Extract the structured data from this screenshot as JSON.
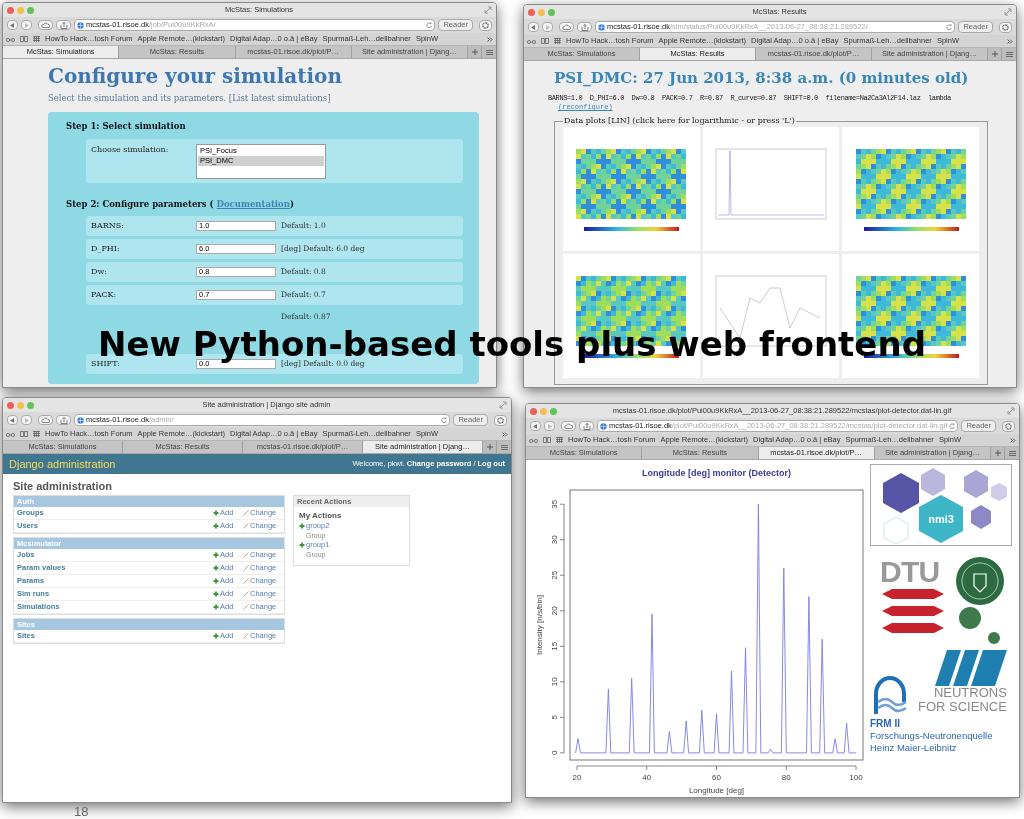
{
  "slide": {
    "headline": "New Python-based tools plus web frontend",
    "page_number": "18"
  },
  "windows": [
    {
      "kind": "simulations",
      "title": "McStas: Simulations",
      "url_host": "mcstas-01.risoe.dk",
      "url_path": "/job/Pui00u9KkRxA/",
      "reader": "Reader",
      "bookmarks": [
        "HowTo Hack…tosh Forum",
        "Apple Remote…(kickstart)",
        "Digital Adap…0 o.ä | eBay",
        "Spurmaß-Leh…dellbahner",
        "SpinW"
      ],
      "tabs": [
        {
          "label": "McStas: Simulations",
          "selected": true
        },
        {
          "label": "McStas: Results",
          "selected": false
        },
        {
          "label": "mcstas-01.risoe.dk/plot/P…",
          "selected": false
        },
        {
          "label": "Site administration | Djang…",
          "selected": false
        }
      ],
      "content": {
        "heading": "Configure your simulation",
        "intro": "Select the simulation and its parameters.",
        "intro_link": "[List latest simulations]",
        "step1": "Step 1: Select simulation",
        "choose_label": "Choose simulation:",
        "options": [
          {
            "label": "PSI_Focus",
            "selected": false
          },
          {
            "label": "PSI_DMC",
            "selected": true
          }
        ],
        "step2": "Step 2: Configure parameters (",
        "step2_link": "Documentation",
        "step2_end": ")",
        "params": [
          {
            "label": "BARNS:",
            "value": "1.0",
            "default": "Default: 1.0"
          },
          {
            "label": "D_PHI:",
            "value": "6.0",
            "default": "[deg] Default: 6.0 deg"
          },
          {
            "label": "Dw:",
            "value": "0.8",
            "default": "Default: 0.8"
          },
          {
            "label": "PACK:",
            "value": "0.7",
            "default": "Default: 0.7"
          },
          {
            "default": "Default: 0.87"
          },
          {
            "label": "SHIFT:",
            "value": "0.0",
            "default": "[deg] Default: 0.0 deg"
          }
        ]
      }
    },
    {
      "kind": "results",
      "title": "McStas: Results",
      "url_host": "mcstas-01.risoe.dk",
      "url_path": "/sim/status/Pui00u9KkRxA__2013-06-27_08:38:21.289522/",
      "reader": "Reader",
      "bookmarks": [
        "HowTo Hack…tosh Forum",
        "Apple Remote…(kickstart)",
        "Digital Adap…0 o.ä | eBay",
        "Spurmaß-Leh…dellbahner",
        "SpinW"
      ],
      "tabs": [
        {
          "label": "McStas: Simulations",
          "selected": false
        },
        {
          "label": "McStas: Results",
          "selected": true
        },
        {
          "label": "mcstas-01.risoe.dk/plot/P…",
          "selected": false
        },
        {
          "label": "Site administration | Djang…",
          "selected": false
        }
      ],
      "content": {
        "heading": "PSI_DMC: 27 Jun 2013, 8:38 a.m. (0 minutes old)",
        "params_line": "BARNS=1.0  D_PHI=6.0  Dw=0.8  PACK=0.7  R=0.87  R_curve=0.87  SHIFT=0.0  filename=Na2Ca3Al2F14.laz  lambda",
        "reconfigure": "(reconfigure)",
        "legend": "Data plots [LIN] (click here for logarithmic - or press 'L')",
        "plots": [
          {
            "kind": "map"
          },
          {
            "kind": "peak"
          },
          {
            "kind": "map"
          },
          {
            "kind": "map"
          },
          {
            "kind": "line"
          },
          {
            "kind": "map"
          }
        ]
      }
    },
    {
      "kind": "admin",
      "title": "Site administration | Django site admin",
      "url_host": "mcstas-01.risoe.dk",
      "url_path": "/admin/",
      "reader": "Reader",
      "bookmarks": [
        "HowTo Hack…tosh Forum",
        "Apple Remote…(kickstart)",
        "Digital Adap…0 o.ä | eBay",
        "Spurmaß-Leh…dellbahner",
        "SpinW"
      ],
      "tabs": [
        {
          "label": "McStas: Simulations",
          "selected": false
        },
        {
          "label": "McStas: Results",
          "selected": false
        },
        {
          "label": "mcstas-01.risoe.dk/plot/P…",
          "selected": false
        },
        {
          "label": "Site administration | Djang…",
          "selected": true
        }
      ],
      "content": {
        "brand": "Django administration",
        "welcome": "Welcome, pkwi.",
        "user_links": [
          "Change password",
          "Log out"
        ],
        "link_separator": "/",
        "page_title": "Site administration",
        "modules": [
          {
            "name": "Auth",
            "models": [
              {
                "name": "Groups",
                "add": "Add",
                "change": "Change"
              },
              {
                "name": "Users",
                "add": "Add",
                "change": "Change"
              }
            ]
          },
          {
            "name": "Mcsimulator",
            "models": [
              {
                "name": "Jobs",
                "add": "Add",
                "change": "Change"
              },
              {
                "name": "Param values",
                "add": "Add",
                "change": "Change"
              },
              {
                "name": "Params",
                "add": "Add",
                "change": "Change"
              },
              {
                "name": "Sim runs",
                "add": "Add",
                "change": "Change"
              },
              {
                "name": "Simulations",
                "add": "Add",
                "change": "Change"
              }
            ]
          },
          {
            "name": "Sites",
            "models": [
              {
                "name": "Sites",
                "add": "Add",
                "change": "Change"
              }
            ]
          }
        ],
        "recent": {
          "title": "Recent Actions",
          "subtitle": "My Actions",
          "actions": [
            {
              "name": "group2",
              "type": "Group"
            },
            {
              "name": "group1",
              "type": "Group"
            }
          ]
        }
      }
    },
    {
      "kind": "plot",
      "title": "mcstas-01.risoe.dk/plot/Pui00u9KkRxA__2013-06-27_08:38:21.289522/mcstas/plot-detector.dat-lin.gif",
      "url_host": "mcstas-01.risoe.dk",
      "url_path": "/plot/Pui00u9KkRxA__2013-06-27_08:38:21.289522/mcstas/plot-detector.dat-lin.gif",
      "reader": "Reader",
      "bookmarks": [
        "HowTo Hack…tosh Forum",
        "Apple Remote…(kickstart)",
        "Digital Adap…0 o.ä | eBay",
        "Spurmaß-Leh…dellbahner",
        "SpinW"
      ],
      "tabs": [
        {
          "label": "McStas: Simulations",
          "selected": false
        },
        {
          "label": "McStas: Results",
          "selected": false
        },
        {
          "label": "mcstas-01.risoe.dk/plot/P…",
          "selected": true
        },
        {
          "label": "Site administration | Djang…",
          "selected": false
        }
      ],
      "content": {
        "chart_data": {
          "type": "line",
          "title": "Longitude [deg] monitor (Detector)",
          "xlabel": "Longitude [deg]",
          "ylabel": "Intensity [n/s/bin]",
          "x": [
            19.6,
            20.3,
            21,
            28.3,
            29,
            29.7,
            35,
            35.7,
            36.4,
            40.8,
            41.5,
            42.2,
            45.8,
            46.5,
            47.2,
            50.6,
            51.3,
            52,
            55.1,
            55.8,
            56.5,
            59.3,
            60,
            60.7,
            63.6,
            64.3,
            65,
            67.6,
            68.3,
            69,
            71.3,
            72,
            72.7,
            74.8,
            75.5,
            76.2,
            78.6,
            79.3,
            80,
            85.8,
            86.5,
            87.2,
            89.6,
            90.3,
            91,
            93.3,
            94,
            94.7,
            96.6,
            97.3,
            98,
            100
          ],
          "series": [
            {
              "color": "#7c7ce6",
              "values": [
                0,
                2,
                0,
                0,
                9,
                0,
                0,
                10.5,
                0,
                0,
                19.5,
                0,
                0,
                3,
                0,
                0,
                4.5,
                0,
                0,
                6,
                0,
                0,
                5.5,
                0,
                0,
                11.5,
                0,
                0,
                14.8,
                0,
                0,
                35,
                0,
                0,
                0.5,
                0,
                0,
                26,
                0,
                0,
                22,
                0,
                0,
                16,
                0,
                0,
                2,
                0,
                0,
                4.2,
                0,
                0
              ]
            }
          ],
          "xlim": [
            18,
            102
          ],
          "ylim": [
            -1,
            37
          ],
          "xticks": [
            20,
            40,
            60,
            80,
            100
          ],
          "yticks": [
            0,
            5,
            10,
            15,
            20,
            25,
            30,
            35
          ]
        },
        "logos": {
          "nmi3": "nmi3",
          "dtu": "DTU",
          "ill": [
            "NEUTRONS",
            "FOR SCIENCE"
          ],
          "frm": [
            "FRM II",
            "Forschungs-Neutronenquelle",
            "Heinz Maier-Leibnitz"
          ]
        }
      }
    }
  ]
}
